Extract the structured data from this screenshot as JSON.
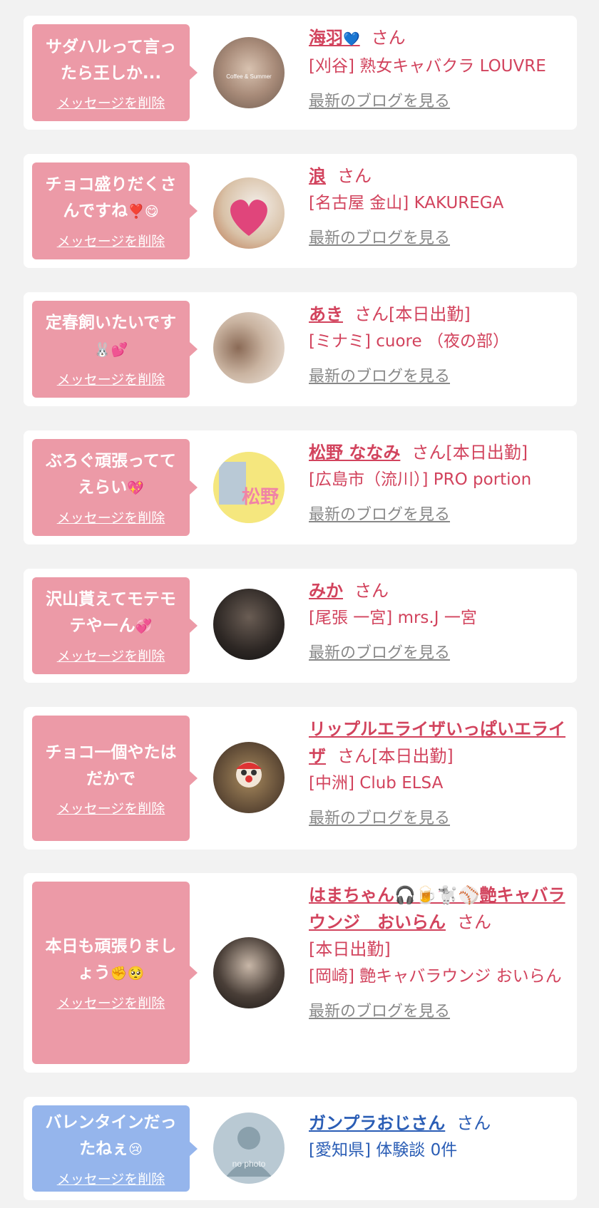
{
  "common": {
    "delete_label": "メッセージを削除",
    "blog_label": "最新のブログを見る",
    "san": "さん",
    "working_today": "[本日出勤]"
  },
  "items": [
    {
      "message": "サダハルって言ったら王しか...",
      "name": "海羽",
      "name_emoji": "💙",
      "status": "",
      "shop": "[刈谷] 熟女キャバクラ LOUVRE",
      "bubble_color": "pink",
      "avatar_desc": "coffee-photo"
    },
    {
      "message": "チョコ盛りだくさんですね",
      "message_emoji": "❣️😋",
      "name": "浪",
      "status": "",
      "shop": "[名古屋 金山] KAKUREGA",
      "bubble_color": "pink",
      "avatar_desc": "heart-sticker-photo"
    },
    {
      "message": "定春飼いたいです",
      "message_emoji": "🐰💕",
      "name": "あき",
      "status": "[本日出勤]",
      "shop": "[ミナミ] cuore （夜の部）",
      "bubble_color": "pink",
      "avatar_desc": "woman-photo"
    },
    {
      "message": "ぶろぐ頑張っててえらい",
      "message_emoji": "💖",
      "name": "松野 ななみ",
      "status": "[本日出勤]",
      "shop": "[広島市（流川）] PRO portion",
      "bubble_color": "pink",
      "avatar_desc": "松野"
    },
    {
      "message": "沢山貰えてモテモテやーん",
      "message_emoji": "💞",
      "name": "みか",
      "status": "",
      "shop": "[尾張 一宮] mrs.J 一宮",
      "bubble_color": "pink",
      "avatar_desc": "legs-photo"
    },
    {
      "message": "チョコ一個やたはだかで",
      "name": "リップルエライザいっぱいエライザ",
      "status": "[本日出勤]",
      "shop": "[中洲] Club ELSA",
      "bubble_color": "pink",
      "avatar_desc": "mask-photo"
    },
    {
      "message": "本日も頑張りましょう",
      "message_emoji": "✊🥺",
      "name": "はまちゃん🎧🍺🐩⚾艶キャバラウンジ　おいらん",
      "status": "[本日出勤]",
      "shop": "[岡崎] 艶キャバラウンジ おいらん",
      "bubble_color": "pink",
      "avatar_desc": "bar-photo"
    },
    {
      "message": "バレンタインだったねぇ",
      "message_emoji": "😢",
      "name": "ガンプラおじさん",
      "status": "",
      "shop": "[愛知県] 体験談 0件",
      "bubble_color": "blue",
      "avatar_desc": "no photo"
    }
  ],
  "colors": {
    "pink": "#ec9aa7",
    "blue": "#95b5ec",
    "name_pink": "#d2435d",
    "name_blue": "#2a5db5",
    "link_gray": "#888888"
  }
}
